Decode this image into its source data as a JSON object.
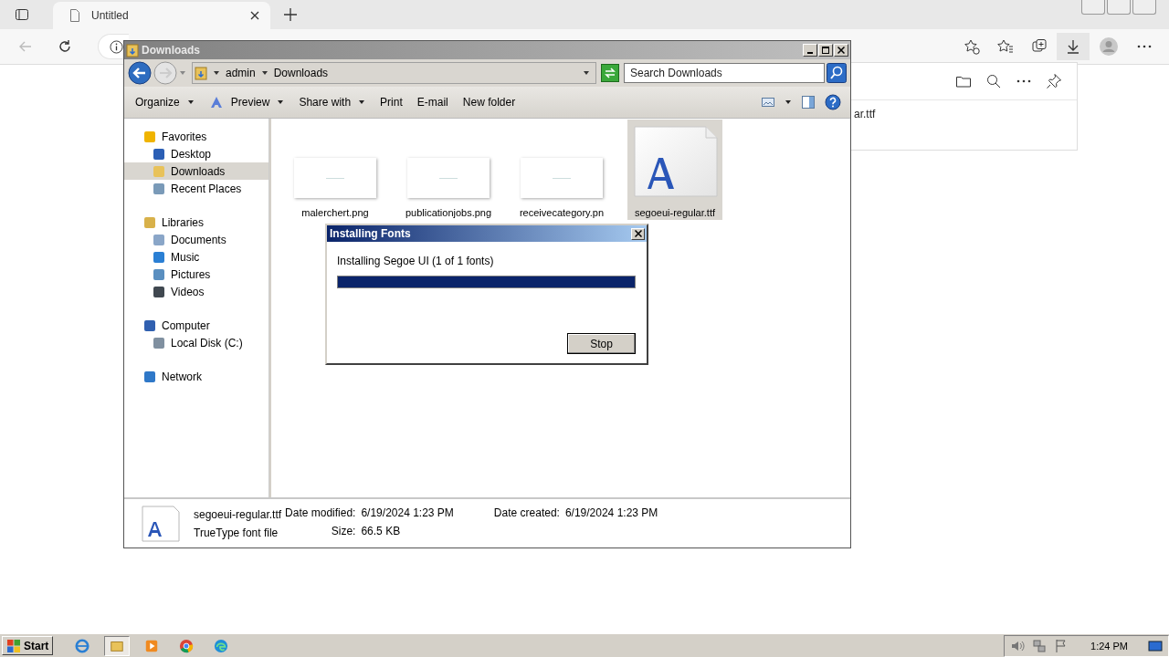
{
  "browser": {
    "tab": {
      "title": "Untitled",
      "selected": true
    },
    "downloads_panel": {
      "file": "ar.ttf"
    }
  },
  "explorer": {
    "title": "Downloads",
    "breadcrumb": [
      "admin",
      "Downloads"
    ],
    "search": {
      "placeholder": "Search Downloads"
    },
    "toolbar": [
      {
        "label": "Organize",
        "kind": "menu"
      },
      {
        "label": "Preview",
        "kind": "menu"
      },
      {
        "label": "Share with",
        "kind": "menu"
      },
      {
        "label": "Print",
        "kind": "plain"
      },
      {
        "label": "E-mail",
        "kind": "plain"
      },
      {
        "label": "New folder",
        "kind": "plain"
      }
    ],
    "nav": [
      {
        "label": "Favorites",
        "selected": false,
        "children": [
          {
            "label": "Desktop",
            "selected": false
          },
          {
            "label": "Downloads",
            "selected": true
          },
          {
            "label": "Recent Places",
            "selected": false
          }
        ]
      },
      {
        "label": "Libraries",
        "selected": false,
        "children": [
          {
            "label": "Documents",
            "selected": false
          },
          {
            "label": "Music",
            "selected": false
          },
          {
            "label": "Pictures",
            "selected": false
          },
          {
            "label": "Videos",
            "selected": false
          }
        ]
      },
      {
        "label": "Computer",
        "selected": false,
        "children": [
          {
            "label": "Local Disk (C:)",
            "selected": false
          }
        ]
      },
      {
        "label": "Network",
        "selected": false
      }
    ],
    "files": [
      {
        "name": "malerchert.png",
        "kind": "image",
        "selected": false
      },
      {
        "name": "publicationjobs.png",
        "kind": "image",
        "selected": false
      },
      {
        "name": "receivecategory.pn",
        "kind": "image",
        "selected": false
      },
      {
        "name": "segoeui-regular.ttf",
        "kind": "font",
        "selected": true
      }
    ],
    "details": {
      "name": "segoeui-regular.ttf",
      "type": "TrueType font file",
      "modified_label": "Date modified:",
      "modified": "6/19/2024 1:23 PM",
      "created_label": "Date created:",
      "created": "6/19/2024 1:23 PM",
      "size_label": "Size:",
      "size": "66.5 KB"
    }
  },
  "dialog": {
    "title": "Installing Fonts",
    "message": "Installing Segoe UI (1 of 1 fonts)",
    "level": 1.0,
    "button": "Stop"
  },
  "taskbar": {
    "start": "Start",
    "apps": [
      {
        "kind": "ie",
        "selected": false
      },
      {
        "kind": "explorer",
        "selected": true
      },
      {
        "kind": "media",
        "selected": false
      },
      {
        "kind": "chrome",
        "selected": false
      },
      {
        "kind": "edge",
        "selected": false
      }
    ],
    "clock": "1:24 PM"
  }
}
